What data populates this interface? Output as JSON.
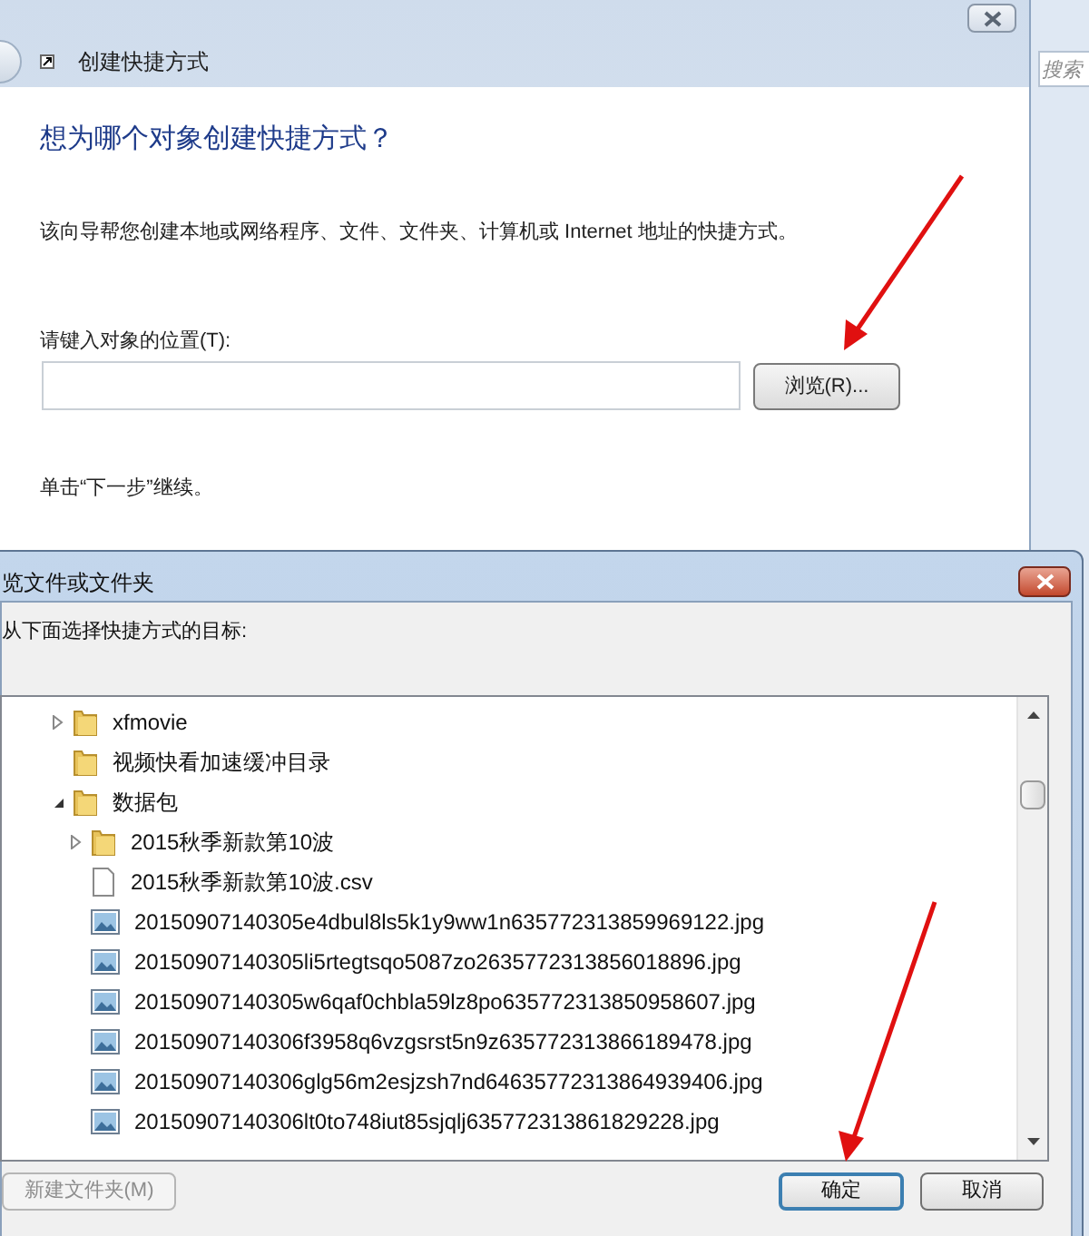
{
  "wizard": {
    "title": "创建快捷方式",
    "heading": "想为哪个对象创建快捷方式？",
    "description": "该向导帮您创建本地或网络程序、文件、文件夹、计算机或 Internet 地址的快捷方式。",
    "location_label": "请键入对象的位置(T):",
    "browse_button": "浏览(R)...",
    "hint": "单击“下一步”继续。"
  },
  "side_search": {
    "placeholder": "搜索"
  },
  "browse_dialog": {
    "title": "览文件或文件夹",
    "prompt": "从下面选择快捷方式的目标:",
    "tree": [
      {
        "kind": "folder",
        "label": "xfmovie",
        "expanded": false
      },
      {
        "kind": "folder",
        "label": "视频快看加速缓冲目录"
      },
      {
        "kind": "folder",
        "label": "数据包",
        "expanded": true,
        "children": [
          {
            "kind": "folder",
            "label": "2015秋季新款第10波",
            "expanded": false
          },
          {
            "kind": "file",
            "label": "2015秋季新款第10波.csv"
          },
          {
            "kind": "image",
            "label": "20150907140305e4dbul8ls5k1y9ww1n635772313859969122.jpg"
          },
          {
            "kind": "image",
            "label": "20150907140305li5rtegtsqo5087zo2635772313856018896.jpg"
          },
          {
            "kind": "image",
            "label": "20150907140305w6qaf0chbla59lz8po635772313850958607.jpg"
          },
          {
            "kind": "image",
            "label": "20150907140306f3958q6vzgsrst5n9z635772313866189478.jpg"
          },
          {
            "kind": "image",
            "label": "20150907140306glg56m2esjzsh7nd64635772313864939406.jpg"
          },
          {
            "kind": "image",
            "label": "20150907140306lt0to748iut85sjqlj635772313861829228.jpg"
          }
        ]
      }
    ],
    "buttons": [
      {
        "label": "新建文件夹(M)",
        "disabled": true
      },
      {
        "label": "确定",
        "disabled": false,
        "default": true
      },
      {
        "label": "取消",
        "disabled": false,
        "default": false
      }
    ]
  }
}
